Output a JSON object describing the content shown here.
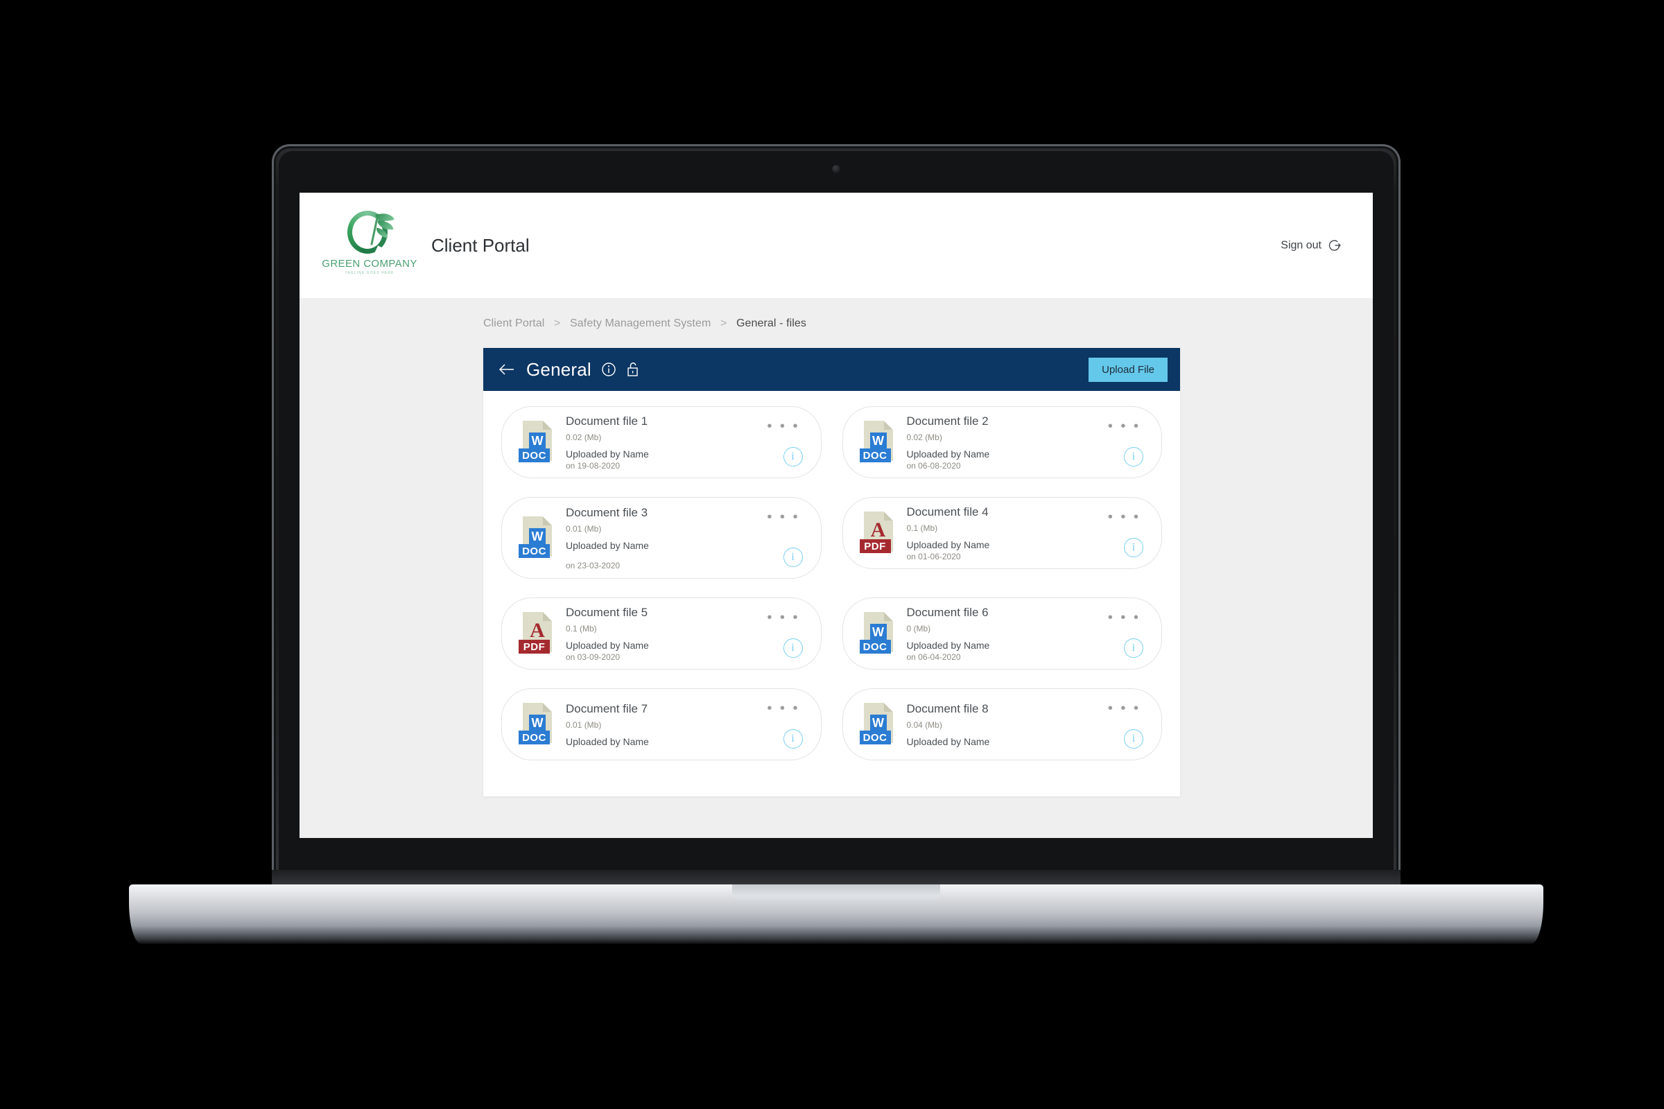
{
  "header": {
    "logo": {
      "name": "GREEN COMPANY",
      "tagline": "TAGLINE GOES HERE"
    },
    "app_title": "Client Portal",
    "signout_label": "Sign out"
  },
  "breadcrumb": {
    "items": [
      "Client Portal",
      "Safety Management System",
      "General - files"
    ],
    "separator": ">"
  },
  "panel": {
    "title": "General",
    "upload_label": "Upload File",
    "accent_color": "#0c3663",
    "button_color": "#64c8eb"
  },
  "files": [
    {
      "name": "Document file 1",
      "size": "0.02 (Mb)",
      "uploader": "Uploaded by Name",
      "date": "on 19-08-2020",
      "type": "DOC",
      "spaced": false
    },
    {
      "name": "Document file 2",
      "size": "0.02 (Mb)",
      "uploader": "Uploaded by Name",
      "date": "on 06-08-2020",
      "type": "DOC",
      "spaced": false
    },
    {
      "name": "Document file 3",
      "size": "0.01 (Mb)",
      "uploader": "Uploaded by Name",
      "date": "on 23-03-2020",
      "type": "DOC",
      "spaced": true
    },
    {
      "name": "Document file 4",
      "size": "0.1 (Mb)",
      "uploader": "Uploaded by Name",
      "date": "on 01-06-2020",
      "type": "PDF",
      "spaced": false
    },
    {
      "name": "Document file 5",
      "size": "0.1 (Mb)",
      "uploader": "Uploaded by Name",
      "date": "on 03-09-2020",
      "type": "PDF",
      "spaced": false
    },
    {
      "name": "Document file 6",
      "size": "0 (Mb)",
      "uploader": "Uploaded by Name",
      "date": "on 06-04-2020",
      "type": "DOC",
      "spaced": false
    },
    {
      "name": "Document file 7",
      "size": "0.01 (Mb)",
      "uploader": "Uploaded by Name",
      "date": "",
      "type": "DOC",
      "spaced": false
    },
    {
      "name": "Document file 8",
      "size": "0.04 (Mb)",
      "uploader": "Uploaded by Name",
      "date": "",
      "type": "DOC",
      "spaced": false
    }
  ],
  "icons": {
    "doc_badge": "W",
    "doc_band": "DOC",
    "pdf_band": "PDF",
    "pdf_glyph": "A",
    "dots": "• • •",
    "info": "i"
  }
}
